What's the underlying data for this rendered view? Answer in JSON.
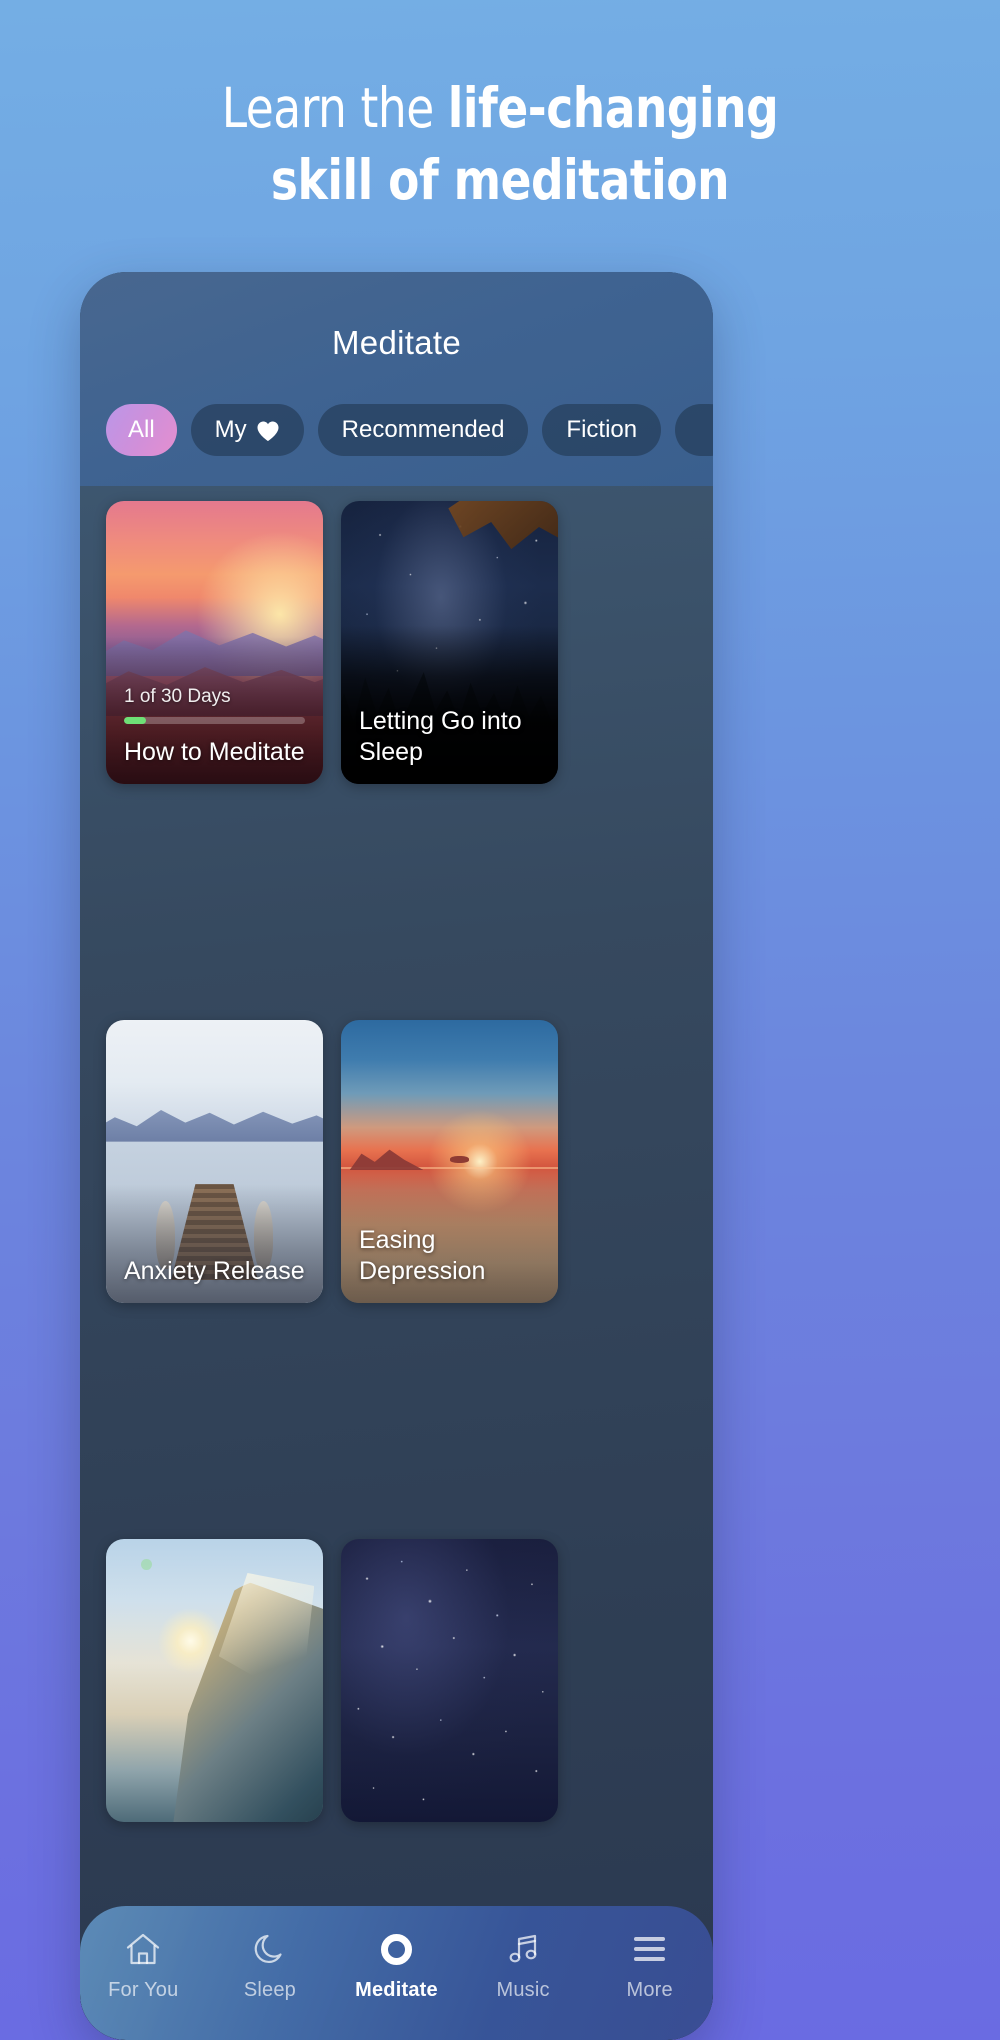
{
  "headline": {
    "line1_regular": "Learn the ",
    "line1_bold": "life-changing",
    "line2_bold": "skill of meditation"
  },
  "app": {
    "title": "Meditate",
    "filters": [
      {
        "label": "All",
        "active": true,
        "icon": null
      },
      {
        "label": "My",
        "active": false,
        "icon": "heart-icon"
      },
      {
        "label": "Recommended",
        "active": false,
        "icon": null
      },
      {
        "label": "Fiction",
        "active": false,
        "icon": null
      },
      {
        "label": "",
        "active": false,
        "icon": null
      }
    ],
    "cards": [
      {
        "title": "How to Meditate",
        "subtitle": "1 of 30 Days",
        "progress_percent": 12,
        "progress_color": "#6ee076",
        "art": "sunset-mountains"
      },
      {
        "title": "Letting Go into Sleep",
        "subtitle": "",
        "art": "night-sky-trees"
      },
      {
        "title": "Anxiety Release",
        "subtitle": "",
        "art": "lake-dock"
      },
      {
        "title": "Easing Depression",
        "subtitle": "",
        "art": "ocean-sunset"
      },
      {
        "title": "",
        "subtitle": "",
        "art": "ocean-wave"
      },
      {
        "title": "",
        "subtitle": "",
        "art": "starfield"
      }
    ],
    "tabs": [
      {
        "label": "For You",
        "icon": "home-icon",
        "active": false
      },
      {
        "label": "Sleep",
        "icon": "moon-icon",
        "active": false
      },
      {
        "label": "Meditate",
        "icon": "ring-icon",
        "active": true
      },
      {
        "label": "Music",
        "icon": "music-note-icon",
        "active": false
      },
      {
        "label": "More",
        "icon": "hamburger-icon",
        "active": false
      }
    ]
  },
  "colors": {
    "background_top": "#74aee4",
    "background_bottom": "#6a6be2",
    "pill_active_gradient_start": "#bb96e8",
    "pill_active_gradient_end": "#e58fcf",
    "progress_green": "#6ee076",
    "text_white": "#ffffff"
  }
}
